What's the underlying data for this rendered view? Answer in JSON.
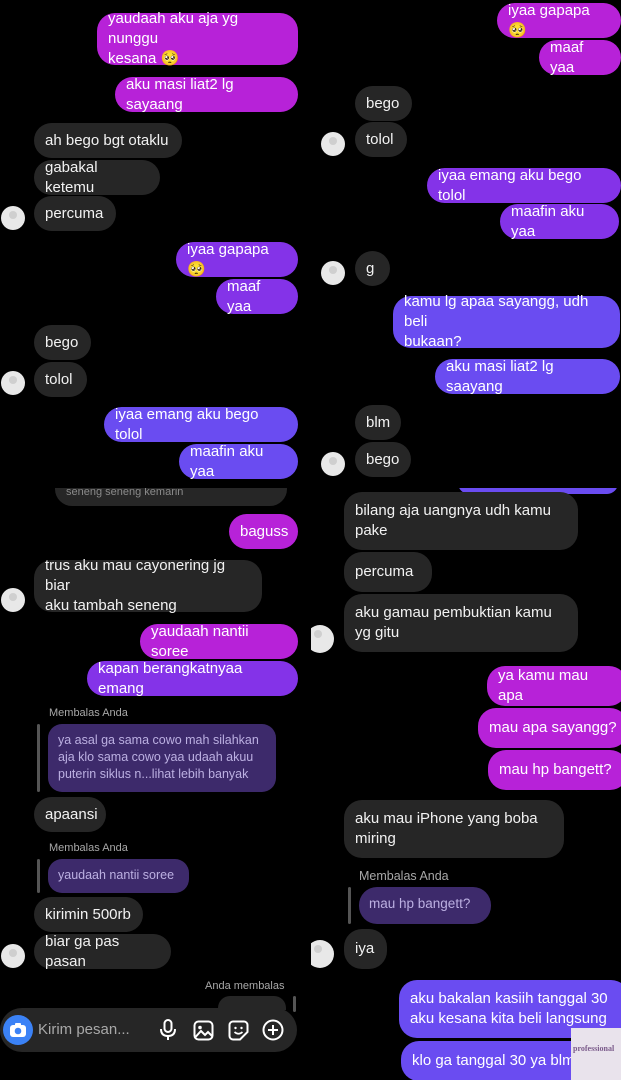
{
  "panel1": {
    "messages": [
      {
        "text": "yaudaah aku aja yg nunggu\nkesana 🥺"
      },
      {
        "text": "aku masi liat2 lg sayaang"
      },
      {
        "text": "ah bego bgt otaklu"
      },
      {
        "text": "gabakal ketemu"
      },
      {
        "text": "percuma"
      },
      {
        "text": "iyaa gapapa 🥺"
      },
      {
        "text": "maaf yaa"
      },
      {
        "text": "bego"
      },
      {
        "text": "tolol"
      },
      {
        "text": "iyaa emang aku bego tolol"
      },
      {
        "text": "maafin aku yaa"
      }
    ]
  },
  "panel2": {
    "messages": [
      {
        "text": "iyaa gapapa 🥺"
      },
      {
        "text": "maaf yaa"
      },
      {
        "text": "bego"
      },
      {
        "text": "tolol"
      },
      {
        "text": "iyaa emang aku bego tolol"
      },
      {
        "text": "maafin aku yaa"
      },
      {
        "text": "g"
      },
      {
        "text": "kamu lg apaa sayangg, udh beli\nbukaan?"
      },
      {
        "text": "aku masi liat2 lg saayang"
      },
      {
        "text": "blm"
      },
      {
        "text": "bego"
      }
    ]
  },
  "panel3": {
    "cut_text": "seneng seneng kemarin",
    "messages": [
      {
        "text": "baguss"
      },
      {
        "text": "trus aku mau cayonering jg biar\naku tambah seneng"
      },
      {
        "text": "yaudaah nantii soree"
      },
      {
        "text": "kapan berangkatnyaa emang"
      },
      {
        "text": "apaansi"
      },
      {
        "text": "kirimin 500rb"
      },
      {
        "text": "biar ga pas pasan"
      }
    ],
    "reply1": {
      "label": "Membalas Anda",
      "quote": "ya asal ga sama cowo mah silahkan\naja klo sama cowo yaa udaah akuu\nputerin siklus n...lihat lebih banyak"
    },
    "reply2": {
      "label": "Membalas Anda",
      "quote": "yaudaah nantii soree"
    },
    "reply3": {
      "label": "Anda membalas"
    },
    "composer": {
      "placeholder": "Kirim pesan..."
    }
  },
  "panel4": {
    "messages": [
      {
        "text": "bilang aja uangnya udh kamu\npake"
      },
      {
        "text": "percuma"
      },
      {
        "text": "aku gamau pembuktian kamu\nyg gitu"
      },
      {
        "text": "ya kamu mau apa"
      },
      {
        "text": "mau apa sayangg?"
      },
      {
        "text": "mau hp bangett?"
      },
      {
        "text": "aku mau iPhone yang boba\nmiring"
      },
      {
        "text": "iya"
      },
      {
        "text": "aku bakalan kasiih tanggal 30\naku kesana kita beli langsung"
      },
      {
        "text": "klo ga tanggal 30 ya blm beli"
      }
    ],
    "reply1": {
      "label": "Membalas Anda",
      "quote": "mau hp bangett?"
    }
  },
  "watermark": {
    "text": "professional"
  },
  "icons": [
    "camera-icon",
    "microphone-icon",
    "gallery-icon",
    "sticker-icon",
    "plus-icon"
  ],
  "colors": {
    "incoming": "#262626",
    "outgoing_magenta": "#b722d8",
    "outgoing_purple": "#8433e8",
    "outgoing_violet": "#6a4cf1",
    "composer_camera": "#3b82f6"
  }
}
